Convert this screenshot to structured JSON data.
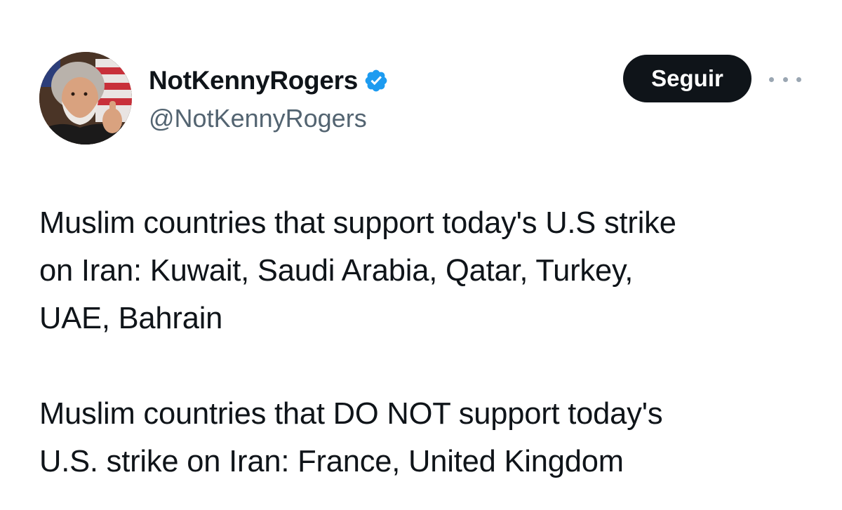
{
  "author": {
    "display_name": "NotKennyRogers",
    "handle": "@NotKennyRogers",
    "verified": true,
    "avatar_icon": "profile-photo-with-flag"
  },
  "actions": {
    "follow_label": "Seguir",
    "more_icon": "more-horizontal-icon"
  },
  "tweet": {
    "paragraphs": [
      "Muslim countries that support today's U.S strike\non Iran: Kuwait, Saudi Arabia, Qatar, Turkey,\nUAE, Bahrain",
      "Muslim countries that DO NOT support today's\nU.S. strike on Iran: France, United Kingdom"
    ]
  },
  "colors": {
    "verified_badge": "#1d9bf0",
    "follow_button_bg": "#0f1419",
    "handle_text": "#536471"
  }
}
